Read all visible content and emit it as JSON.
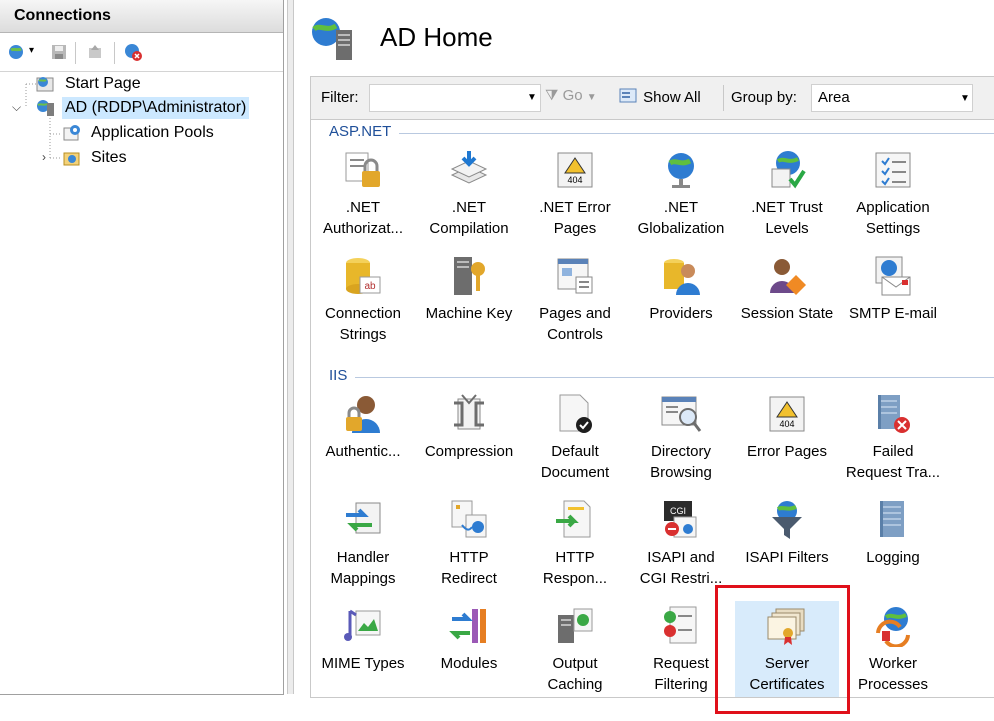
{
  "connections": {
    "title": "Connections",
    "toolbar_icons": [
      "connect-icon",
      "save-icon",
      "up-icon",
      "disconnect-icon"
    ],
    "tree": [
      {
        "label": "Start Page",
        "icon": "start-page-icon"
      },
      {
        "label": "AD (RDDP\\Administrator)",
        "icon": "server-icon",
        "selected": true
      },
      {
        "label": "Application Pools",
        "icon": "app-pools-icon"
      },
      {
        "label": "Sites",
        "icon": "sites-icon"
      }
    ]
  },
  "header": {
    "title": "AD Home"
  },
  "filterbar": {
    "filter_label": "Filter:",
    "go_label": "Go",
    "show_all_label": "Show All",
    "group_by_label": "Group by:",
    "group_by_value": "Area"
  },
  "sections": [
    {
      "name": "ASP.NET",
      "features": [
        {
          "label": ".NET\nAuthorizat...",
          "icon": "net-authorization-icon"
        },
        {
          "label": ".NET\nCompilation",
          "icon": "net-compilation-icon"
        },
        {
          "label": ".NET Error\nPages",
          "icon": "net-error-pages-icon"
        },
        {
          "label": ".NET\nGlobalization",
          "icon": "net-globalization-icon"
        },
        {
          "label": ".NET Trust\nLevels",
          "icon": "net-trust-levels-icon"
        },
        {
          "label": "Application\nSettings",
          "icon": "application-settings-icon"
        },
        {
          "label": "Connection\nStrings",
          "icon": "connection-strings-icon"
        },
        {
          "label": "Machine Key",
          "icon": "machine-key-icon"
        },
        {
          "label": "Pages and\nControls",
          "icon": "pages-controls-icon"
        },
        {
          "label": "Providers",
          "icon": "providers-icon"
        },
        {
          "label": "Session State",
          "icon": "session-state-icon"
        },
        {
          "label": "SMTP E-mail",
          "icon": "smtp-email-icon"
        }
      ]
    },
    {
      "name": "IIS",
      "features": [
        {
          "label": "Authentic...",
          "icon": "authentication-icon"
        },
        {
          "label": "Compression",
          "icon": "compression-icon"
        },
        {
          "label": "Default\nDocument",
          "icon": "default-document-icon"
        },
        {
          "label": "Directory\nBrowsing",
          "icon": "directory-browsing-icon"
        },
        {
          "label": "Error Pages",
          "icon": "error-pages-icon"
        },
        {
          "label": "Failed\nRequest Tra...",
          "icon": "failed-request-tracing-icon"
        },
        {
          "label": "Handler\nMappings",
          "icon": "handler-mappings-icon"
        },
        {
          "label": "HTTP\nRedirect",
          "icon": "http-redirect-icon"
        },
        {
          "label": "HTTP\nRespon...",
          "icon": "http-response-headers-icon"
        },
        {
          "label": "ISAPI and\nCGI Restri...",
          "icon": "isapi-cgi-restrictions-icon"
        },
        {
          "label": "ISAPI Filters",
          "icon": "isapi-filters-icon"
        },
        {
          "label": "Logging",
          "icon": "logging-icon"
        },
        {
          "label": "MIME Types",
          "icon": "mime-types-icon"
        },
        {
          "label": "Modules",
          "icon": "modules-icon"
        },
        {
          "label": "Output\nCaching",
          "icon": "output-caching-icon"
        },
        {
          "label": "Request\nFiltering",
          "icon": "request-filtering-icon"
        },
        {
          "label": "Server\nCertificates",
          "icon": "server-certificates-icon",
          "selected": true
        },
        {
          "label": "Worker\nProcesses",
          "icon": "worker-processes-icon"
        }
      ]
    }
  ],
  "colors": {
    "highlight_box": "#e0101a",
    "selection": "#cce8ff",
    "section_text": "#1f4f99"
  }
}
